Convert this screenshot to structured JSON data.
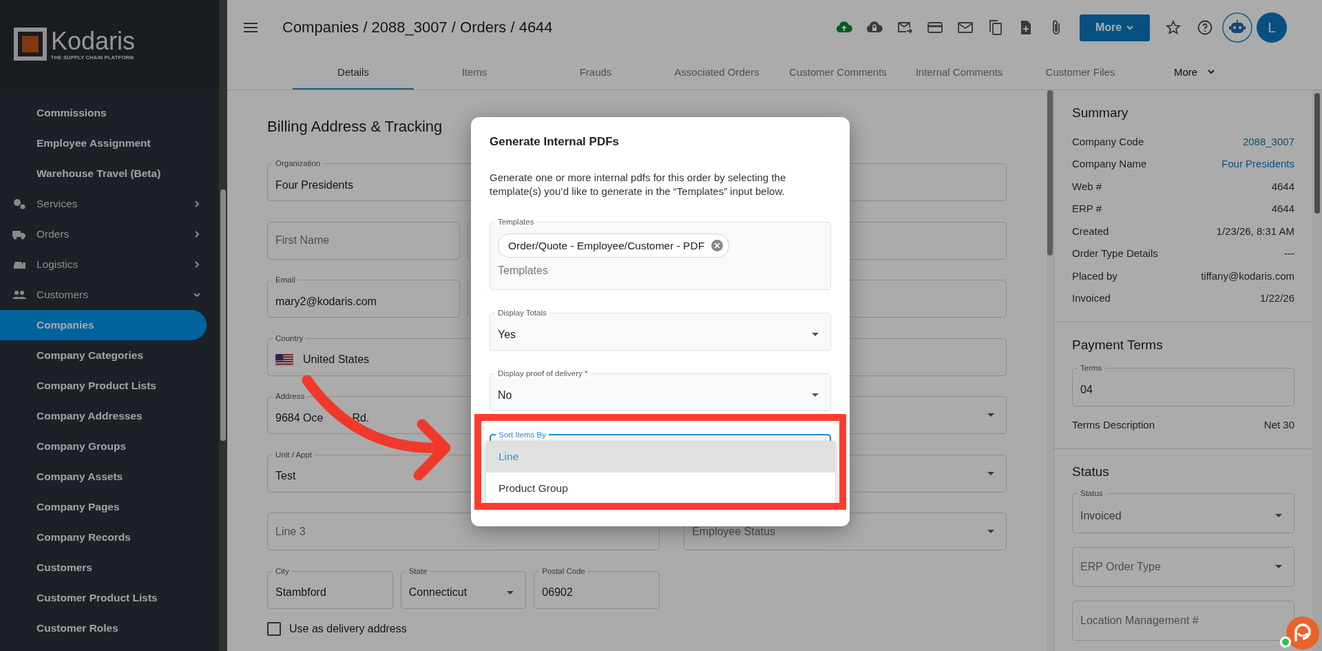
{
  "sidebar": {
    "logo": {
      "name": "Kodaris",
      "tagline": "THE SUPPLY CHAIN PLATFORM"
    },
    "items": [
      {
        "kind": "link",
        "label": "Commissions",
        "selected": false
      },
      {
        "kind": "link",
        "label": "Employee Assignment",
        "selected": false
      },
      {
        "kind": "link",
        "label": "Warehouse Travel (Beta)",
        "selected": false
      },
      {
        "kind": "group",
        "label": "Services",
        "expanded": false,
        "selected": false
      },
      {
        "kind": "group",
        "label": "Orders",
        "expanded": false,
        "selected": false
      },
      {
        "kind": "group",
        "label": "Logistics",
        "expanded": false,
        "selected": false
      },
      {
        "kind": "group",
        "label": "Customers",
        "expanded": true,
        "selected": false
      },
      {
        "kind": "link",
        "label": "Companies",
        "selected": true
      },
      {
        "kind": "link",
        "label": "Company Categories",
        "selected": false
      },
      {
        "kind": "link",
        "label": "Company Product Lists",
        "selected": false
      },
      {
        "kind": "link",
        "label": "Company Addresses",
        "selected": false
      },
      {
        "kind": "link",
        "label": "Company Groups",
        "selected": false
      },
      {
        "kind": "link",
        "label": "Company Assets",
        "selected": false
      },
      {
        "kind": "link",
        "label": "Company Pages",
        "selected": false
      },
      {
        "kind": "link",
        "label": "Company Records",
        "selected": false
      },
      {
        "kind": "link",
        "label": "Customers",
        "selected": false
      },
      {
        "kind": "link",
        "label": "Customer Product Lists",
        "selected": false
      },
      {
        "kind": "link",
        "label": "Customer Roles",
        "selected": false
      }
    ]
  },
  "header": {
    "breadcrumb": "Companies / 2088_3007 / Orders / 4644",
    "more_button": "More",
    "avatar": "L"
  },
  "tabs": [
    {
      "kind": "tab",
      "label": "Details",
      "selected": true
    },
    {
      "kind": "tab",
      "label": "Items",
      "selected": false
    },
    {
      "kind": "tab",
      "label": "Frauds",
      "selected": false
    },
    {
      "kind": "tab",
      "label": "Associated Orders",
      "selected": false
    },
    {
      "kind": "tab",
      "label": "Customer Comments",
      "selected": false
    },
    {
      "kind": "tab",
      "label": "Internal Comments",
      "selected": false
    },
    {
      "kind": "tab",
      "label": "Customer Files",
      "selected": false
    },
    {
      "kind": "menu",
      "label": "More",
      "selected": false
    }
  ],
  "form": {
    "title": "Billing Address & Tracking",
    "left_rows": [
      [
        {
          "kind": "text",
          "label": "Organization",
          "value": "Four Presidents"
        }
      ],
      [
        {
          "kind": "text",
          "placeholder": "First Name"
        },
        {
          "kind": "text"
        }
      ],
      [
        {
          "kind": "text",
          "label": "Email",
          "value": "mary2@kodaris.com"
        },
        {
          "kind": "text"
        }
      ],
      [
        {
          "kind": "country",
          "label": "Country",
          "value": "United States"
        }
      ],
      [
        {
          "kind": "text",
          "label": "Address",
          "value": "9684 Oce",
          "value_tail": "Rd."
        }
      ],
      [
        {
          "kind": "text",
          "label": "Unit / Appt",
          "value": "Test"
        }
      ],
      [
        {
          "kind": "text",
          "placeholder": "Line 3"
        }
      ],
      [
        {
          "kind": "text",
          "label": "City",
          "value": "Stambford"
        },
        {
          "kind": "select",
          "label": "State",
          "value": "Connecticut"
        },
        {
          "kind": "text",
          "label": "Postal Code",
          "value": "06902"
        }
      ]
    ],
    "right_rows": [
      [
        {
          "kind": "text"
        }
      ],
      [
        {
          "kind": "text"
        }
      ],
      [
        {
          "kind": "text"
        }
      ],
      [
        {
          "kind": "text"
        }
      ],
      [
        {
          "kind": "select"
        }
      ],
      [
        {
          "kind": "select"
        }
      ],
      [
        {
          "kind": "select",
          "placeholder": "Employee Status"
        }
      ]
    ],
    "checkbox": {
      "label": "Use as delivery address",
      "checked": false
    }
  },
  "summary": {
    "title": "Summary",
    "rows": [
      {
        "label": "Company Code",
        "value": "2088_3007",
        "kind": "link"
      },
      {
        "label": "Company Name",
        "value": "Four Presidents",
        "kind": "link"
      },
      {
        "label": "Web #",
        "value": "4644",
        "kind": "plain"
      },
      {
        "label": "ERP #",
        "value": "4644",
        "kind": "plain"
      },
      {
        "label": "Created",
        "value": "1/23/26, 8:31 AM",
        "kind": "plain"
      },
      {
        "label": "Order Type Details",
        "value": "---",
        "kind": "plain"
      },
      {
        "label": "Placed by",
        "value": "tiffany@kodaris.com",
        "kind": "plain"
      },
      {
        "label": "Invoiced",
        "value": "1/22/26",
        "kind": "plain"
      }
    ]
  },
  "payment_terms": {
    "title": "Payment Terms",
    "terms_field": {
      "label": "Terms",
      "value": "04"
    },
    "rows": [
      {
        "label": "Terms Description",
        "value": "Net 30"
      }
    ]
  },
  "status": {
    "title": "Status",
    "fields": [
      {
        "kind": "select",
        "label": "Status",
        "value": "Invoiced"
      },
      {
        "kind": "select",
        "placeholder": "ERP Order Type"
      },
      {
        "kind": "text",
        "placeholder": "Location Management #"
      }
    ]
  },
  "modal": {
    "title": "Generate Internal PDFs",
    "description": "Generate one or more internal pdfs for this order by selecting the template(s) you’d like to generate in the “Templates” input below.",
    "templates": {
      "label": "Templates",
      "chips": [
        "Order/Quote - Employee/Customer - PDF"
      ],
      "placeholder": "Templates"
    },
    "fields": [
      {
        "kind": "select",
        "label": "Display Totals",
        "value": "Yes"
      },
      {
        "kind": "select",
        "label": "Display proof of delivery *",
        "value": "No"
      }
    ],
    "sort_field": {
      "label": "Sort Items By",
      "focused": true
    },
    "sort_menu": [
      {
        "label": "Line",
        "selected": true
      },
      {
        "label": "Product Group",
        "selected": false
      }
    ]
  }
}
